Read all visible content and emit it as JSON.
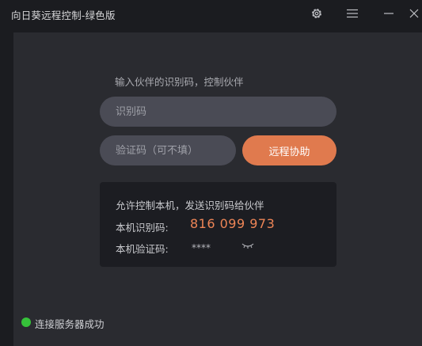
{
  "window": {
    "title": "向日葵远程控制-绿色版"
  },
  "titlebar": {
    "icons": [
      "gear-icon",
      "hamburger-menu-icon",
      "minimize-icon",
      "close-icon"
    ]
  },
  "connect": {
    "prompt": "输入伙伴的识别码，控制伙伴",
    "partner_id_placeholder": "识别码",
    "verify_code_placeholder": "验证码（可不填）",
    "assist_button_label": "远程协助"
  },
  "local": {
    "title": "允许控制本机，发送识别码给伙伴",
    "id_label": "本机识别码:",
    "id_value": "816 099 973",
    "code_label": "本机验证码:",
    "code_value": "****"
  },
  "status": {
    "text": "连接服务器成功",
    "color": "#36c23a"
  },
  "colors": {
    "accent": "#e07a4e",
    "id_text": "#ee8556",
    "background": "#2a2b30",
    "titlebar": "#1b1c20"
  }
}
